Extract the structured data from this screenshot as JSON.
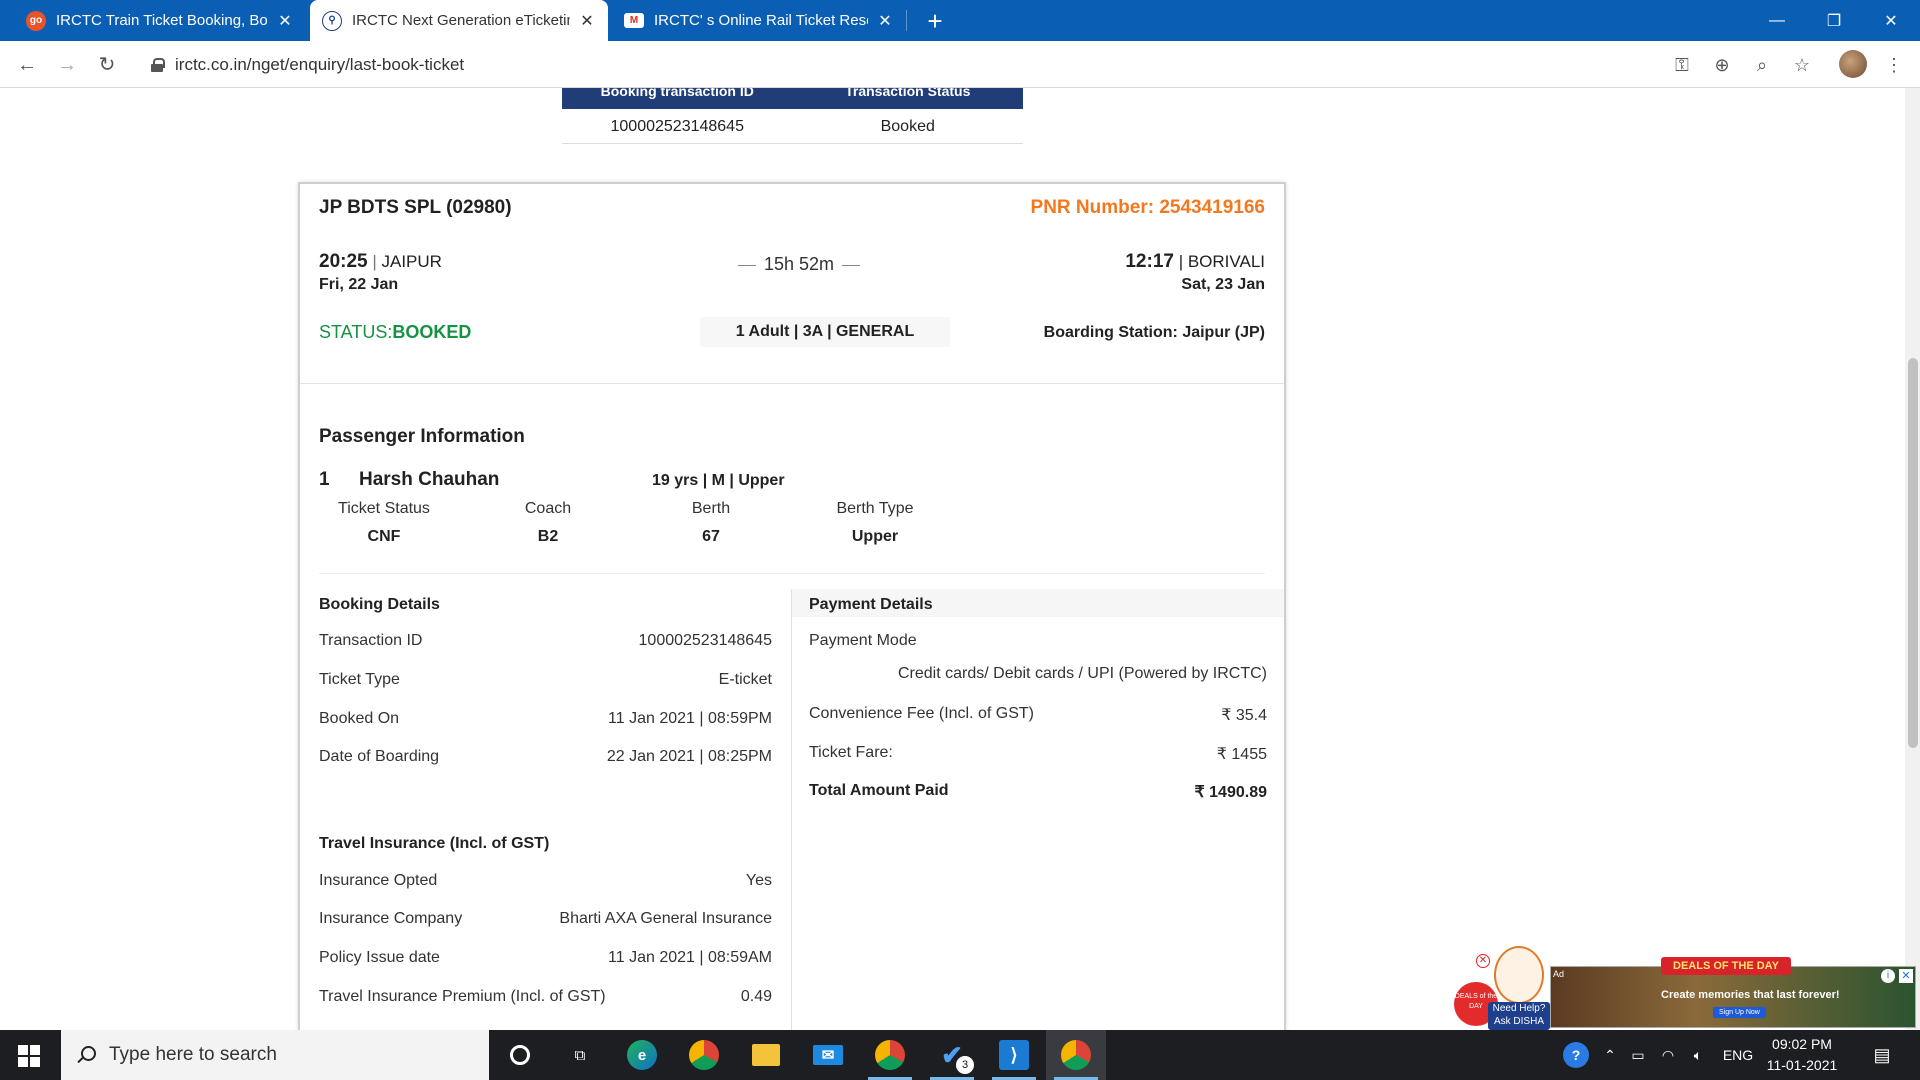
{
  "browser": {
    "tabs": [
      {
        "title": "IRCTC Train Ticket Booking, Book",
        "favicon": "goibibo-icon",
        "active": false
      },
      {
        "title": "IRCTC Next Generation eTicketing",
        "favicon": "irctc-icon",
        "active": true
      },
      {
        "title": "IRCTC' s Online Rail Ticket Reserv",
        "favicon": "gmail-icon",
        "active": false
      }
    ],
    "url": "irctc.co.in/nget/enquiry/last-book-ticket"
  },
  "transaction_table": {
    "headers": [
      "Booking transaction ID",
      "Transaction Status"
    ],
    "row": [
      "100002523148645",
      "Booked"
    ]
  },
  "journey": {
    "train": "JP BDTS SPL (02980)",
    "pnr_label": "PNR Number: 2543419166",
    "departure": {
      "time": "20:25",
      "station": "JAIPUR",
      "date": "Fri, 22 Jan"
    },
    "duration": "15h 52m",
    "arrival": {
      "time": "12:17",
      "station": "BORIVALI",
      "date": "Sat, 23 Jan"
    },
    "status_label": "STATUS:",
    "status_value": "BOOKED",
    "class_info": "1 Adult | 3A | GENERAL",
    "boarding": "Boarding Station: Jaipur (JP)"
  },
  "passenger_section": {
    "title": "Passenger Information",
    "number": "1",
    "name": "Harsh Chauhan",
    "meta": "19 yrs | M | Upper",
    "columns": [
      {
        "label": "Ticket Status",
        "value": "CNF"
      },
      {
        "label": "Coach",
        "value": "B2"
      },
      {
        "label": "Berth",
        "value": "67"
      },
      {
        "label": "Berth Type",
        "value": "Upper"
      }
    ]
  },
  "booking_details": {
    "title": "Booking Details",
    "rows": [
      {
        "label": "Transaction ID",
        "value": "100002523148645"
      },
      {
        "label": "Ticket Type",
        "value": "E-ticket"
      },
      {
        "label": "Booked On",
        "value": "11 Jan 2021 | 08:59PM"
      },
      {
        "label": "Date of Boarding",
        "value": "22 Jan 2021 | 08:25PM"
      }
    ]
  },
  "payment_details": {
    "title": "Payment Details",
    "mode_label": "Payment Mode",
    "mode_value": "Credit cards/ Debit cards / UPI (Powered by IRCTC)",
    "rows": [
      {
        "label": "Convenience Fee (Incl. of GST)",
        "value": "₹ 35.4"
      },
      {
        "label": "Ticket Fare:",
        "value": "₹ 1455"
      }
    ],
    "total_label": "Total Amount Paid",
    "total_value": "₹ 1490.89"
  },
  "insurance": {
    "title": "Travel Insurance (Incl. of GST)",
    "rows": [
      {
        "label": "Insurance Opted",
        "value": "Yes"
      },
      {
        "label": "Insurance Company",
        "value": "Bharti AXA General Insurance"
      },
      {
        "label": "Policy Issue date",
        "value": "11 Jan 2021 | 08:59AM"
      },
      {
        "label": "Travel Insurance Premium (Incl. of GST)",
        "value": "0.49"
      }
    ]
  },
  "help_widget": {
    "text": "Need Help? Ask DISHA",
    "badge": "DEALS of the DAY"
  },
  "ad": {
    "label": "Ad",
    "tag": "DEALS OF THE DAY",
    "message": "Create memories that last forever!",
    "cta": "Sign Up Now"
  },
  "taskbar": {
    "search_placeholder": "Type here to search",
    "language": "ENG",
    "time": "09:02 PM",
    "date": "11-01-2021",
    "badge_count": "3"
  }
}
